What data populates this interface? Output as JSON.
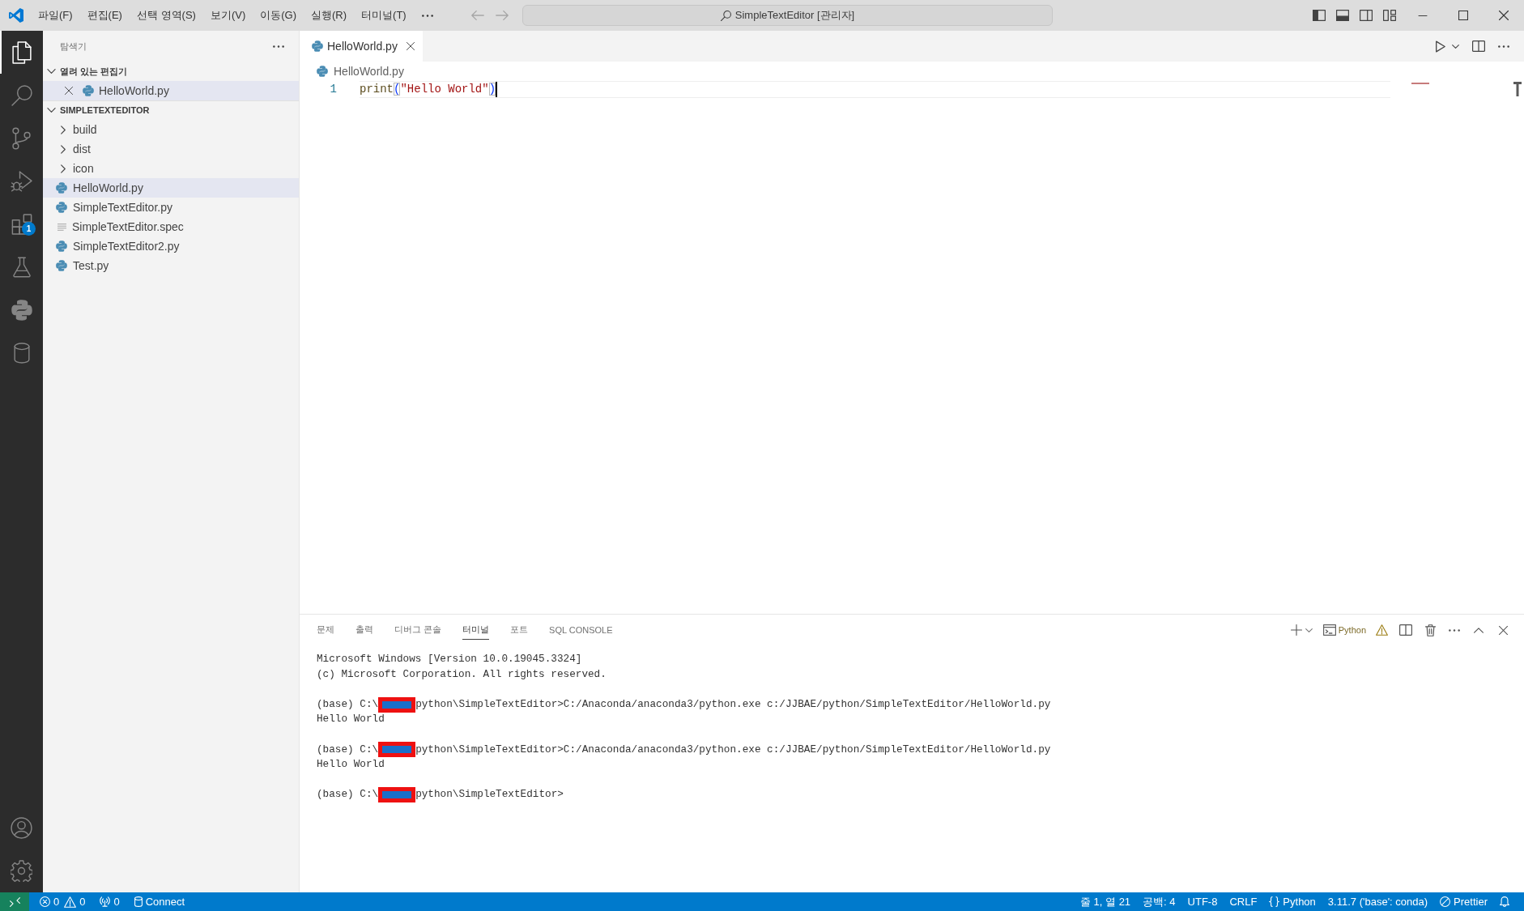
{
  "title_bar": {
    "menus": [
      "파일(F)",
      "편집(E)",
      "선택 영역(S)",
      "보기(V)",
      "이동(G)",
      "실행(R)",
      "터미널(T)"
    ],
    "navigation": [
      {
        "kind": "back",
        "disabled": true
      },
      {
        "kind": "forward",
        "disabled": true
      }
    ],
    "command_center": "SimpleTextEditor [관리자]",
    "layout_controls": [
      {
        "kind": "primary-sidebar",
        "on": true
      },
      {
        "kind": "panel",
        "on": true
      },
      {
        "kind": "secondary-sidebar",
        "on": false
      },
      {
        "kind": "customize"
      }
    ],
    "window_controls": [
      {
        "kind": "minimize"
      },
      {
        "kind": "maximize"
      },
      {
        "kind": "close"
      }
    ]
  },
  "activity_bar": {
    "items": [
      {
        "kind": "explorer",
        "selected": true
      },
      {
        "kind": "search",
        "selected": false
      },
      {
        "kind": "source-control",
        "selected": false
      },
      {
        "kind": "run-debug",
        "selected": false
      },
      {
        "kind": "extensions",
        "selected": false,
        "badge": "1"
      },
      {
        "kind": "testing",
        "selected": false
      },
      {
        "kind": "python",
        "selected": false
      },
      {
        "kind": "database",
        "selected": false
      }
    ],
    "bottom": [
      {
        "kind": "accounts"
      },
      {
        "kind": "settings"
      }
    ]
  },
  "sidebar": {
    "title": "탐색기",
    "sections": [
      {
        "kind": "open-editors",
        "title": "열려 있는 편집기",
        "expanded": true,
        "items": [
          {
            "kind": "python",
            "label": "HelloWorld.py",
            "selected": true
          }
        ]
      },
      {
        "kind": "folder",
        "title": "SIMPLETEXTEDITOR",
        "expanded": true,
        "items": [
          {
            "kind": "folder",
            "label": "build",
            "expanded": false,
            "selected": false
          },
          {
            "kind": "folder",
            "label": "dist",
            "expanded": false,
            "selected": false
          },
          {
            "kind": "folder",
            "label": "icon",
            "expanded": false,
            "selected": false
          },
          {
            "kind": "python",
            "label": "HelloWorld.py",
            "selected": true
          },
          {
            "kind": "python",
            "label": "SimpleTextEditor.py",
            "selected": false
          },
          {
            "kind": "text",
            "label": "SimpleTextEditor.spec",
            "selected": false
          },
          {
            "kind": "python",
            "label": "SimpleTextEditor2.py",
            "selected": false
          },
          {
            "kind": "python",
            "label": "Test.py",
            "selected": false
          }
        ]
      }
    ]
  },
  "editor": {
    "tabs": [
      {
        "label": "HelloWorld.py",
        "selected": true
      }
    ],
    "toolbar": [
      {
        "kind": "run"
      },
      {
        "kind": "dropdown"
      },
      {
        "kind": "split"
      },
      {
        "kind": "more"
      }
    ],
    "breadcrumb": [
      "HelloWorld.py"
    ],
    "lines": [
      {
        "number": "1",
        "current": true,
        "tokens": [
          {
            "kind": "function",
            "text": "print"
          },
          {
            "kind": "bracket",
            "text": "(",
            "matched": true
          },
          {
            "kind": "string",
            "text": "\"Hello World\""
          },
          {
            "kind": "bracket",
            "text": ")",
            "matched": true
          }
        ]
      }
    ]
  },
  "panel": {
    "tabs": [
      {
        "label": "문제",
        "selected": false
      },
      {
        "label": "출력",
        "selected": false
      },
      {
        "label": "디버그 콘솔",
        "selected": false
      },
      {
        "label": "터미널",
        "selected": true
      },
      {
        "label": "포트",
        "selected": false
      },
      {
        "label": "SQL CONSOLE",
        "selected": false
      }
    ],
    "toolbar": [
      {
        "kind": "add"
      },
      {
        "kind": "dropdown"
      },
      {
        "kind": "terminal",
        "text": "Python"
      },
      {
        "kind": "warning"
      },
      {
        "kind": "split"
      },
      {
        "kind": "trash"
      },
      {
        "kind": "more"
      },
      {
        "kind": "maximize"
      },
      {
        "kind": "close"
      }
    ],
    "terminal": {
      "blocks": [
        {
          "lines": [
            {
              "kind": "output",
              "text": "Microsoft Windows [Version 10.0.19045.3324]"
            },
            {
              "kind": "output",
              "text": "(c) Microsoft Corporation. All rights reserved."
            }
          ]
        },
        {
          "lines": [
            {
              "kind": "prompt",
              "prefix": "(base) C:\\",
              "redacted": true,
              "rest": "python\\SimpleTextEditor>C:/Anaconda/anaconda3/python.exe c:/JJBAE/python/SimpleTextEditor/HelloWorld.py"
            },
            {
              "kind": "output",
              "text": "Hello World"
            }
          ]
        },
        {
          "lines": [
            {
              "kind": "prompt",
              "prefix": "(base) C:\\",
              "redacted": true,
              "rest": "python\\SimpleTextEditor>C:/Anaconda/anaconda3/python.exe c:/JJBAE/python/SimpleTextEditor/HelloWorld.py"
            },
            {
              "kind": "output",
              "text": "Hello World"
            }
          ]
        },
        {
          "lines": [
            {
              "kind": "prompt",
              "prefix": "(base) C:\\",
              "redacted": true,
              "rest": "python\\SimpleTextEditor>"
            }
          ]
        }
      ]
    }
  },
  "status_bar": {
    "left": [
      {
        "kind": "remote"
      },
      {
        "kind": "problems",
        "errors": "0",
        "warnings": "0"
      },
      {
        "kind": "ports",
        "text": "0"
      },
      {
        "kind": "database",
        "text": "Connect"
      }
    ],
    "right": [
      {
        "kind": "plain",
        "text": "줄 1, 열 21"
      },
      {
        "kind": "plain",
        "text": "공백: 4"
      },
      {
        "kind": "plain",
        "text": "UTF-8"
      },
      {
        "kind": "plain",
        "text": "CRLF"
      },
      {
        "kind": "language",
        "text": "Python"
      },
      {
        "kind": "plain",
        "text": "3.11.7 ('base': conda)"
      },
      {
        "kind": "prettier",
        "text": "Prettier"
      },
      {
        "kind": "bell"
      }
    ]
  }
}
